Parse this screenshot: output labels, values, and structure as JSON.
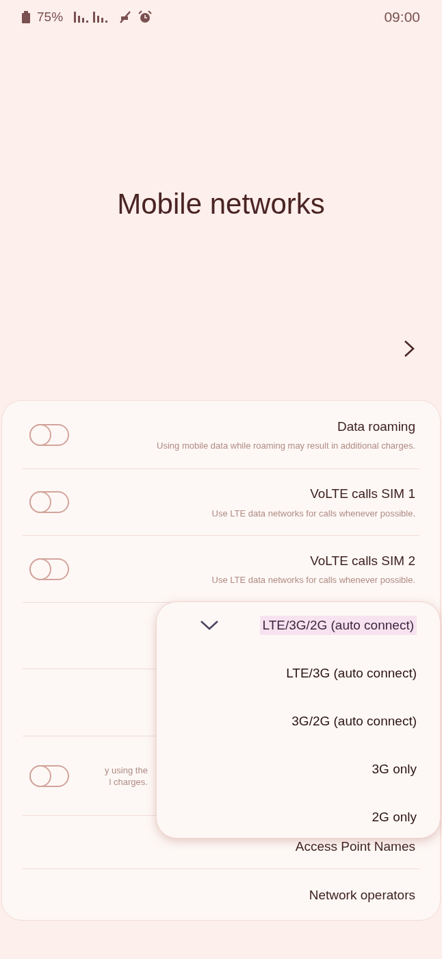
{
  "status_bar": {
    "battery": "75%",
    "time": "09:00"
  },
  "title": "Mobile networks",
  "settings": [
    {
      "kind": "toggle",
      "title": "Data roaming",
      "subtitle": "Using mobile data while roaming may result in additional charges.",
      "on": false
    },
    {
      "kind": "toggle",
      "title": "VoLTE calls SIM 1",
      "subtitle": "Use LTE data networks for calls whenever possible.",
      "on": false
    },
    {
      "kind": "toggle",
      "title": "VoLTE calls SIM 2",
      "subtitle": "Use LTE data networks for calls whenever possible.",
      "on": false
    },
    {
      "kind": "blank"
    },
    {
      "kind": "blank"
    },
    {
      "kind": "toggle_partial",
      "subtitle_lines": [
        "y using the",
        "l charges."
      ],
      "on": false
    },
    {
      "kind": "link",
      "title": "Access Point Names"
    },
    {
      "kind": "link",
      "title": "Network operators"
    }
  ],
  "dropdown": {
    "options": [
      {
        "label": "LTE/3G/2G (auto connect)",
        "selected": true
      },
      {
        "label": "LTE/3G (auto connect)",
        "selected": false
      },
      {
        "label": "3G/2G (auto connect)",
        "selected": false
      },
      {
        "label": "3G only",
        "selected": false
      },
      {
        "label": "2G only",
        "selected": false
      }
    ]
  }
}
